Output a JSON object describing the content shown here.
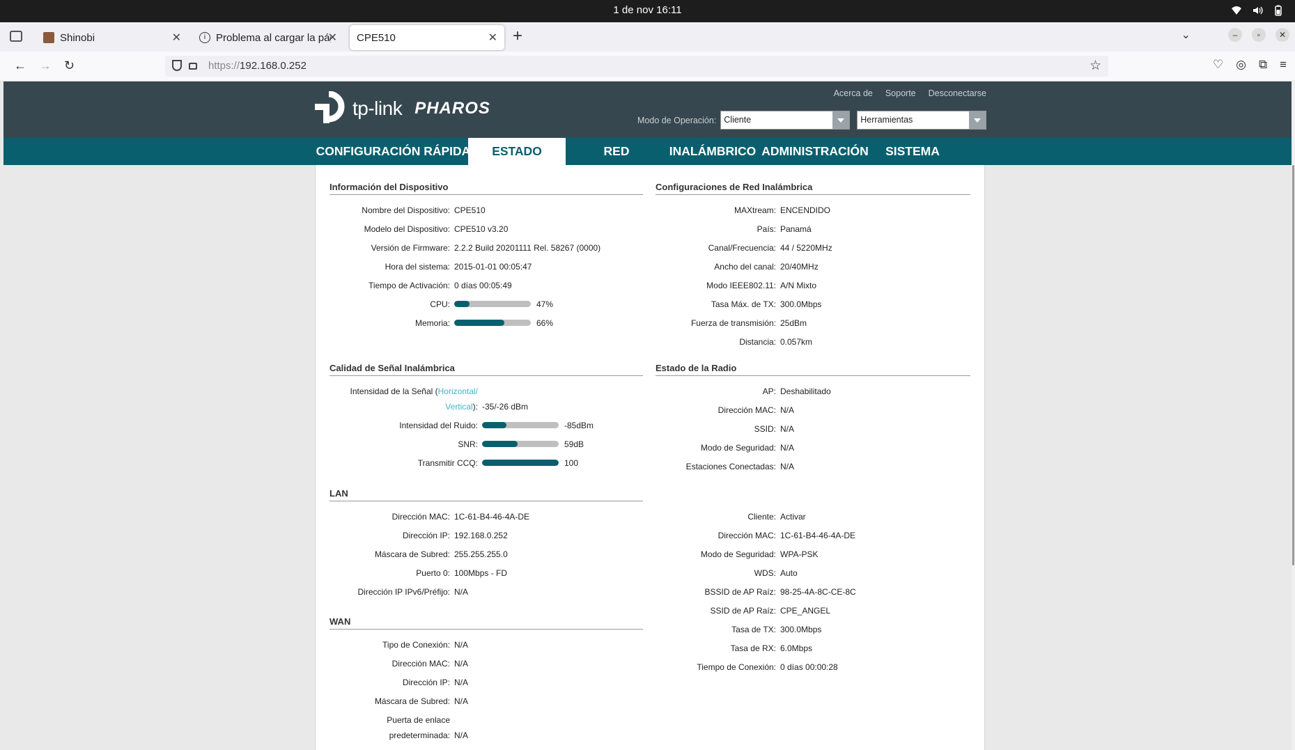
{
  "os": {
    "clock": "1 de nov  16:11"
  },
  "browser": {
    "tabs": [
      {
        "title": "Shinobi",
        "icon": "shinobi-icon"
      },
      {
        "title": "Problema al cargar la pág",
        "icon": "info-icon"
      },
      {
        "title": "CPE510",
        "icon": "",
        "active": true
      }
    ],
    "url_proto": "https://",
    "url_host": "192.168.0.252"
  },
  "header": {
    "brand": "tp-link",
    "product": "PHAROS",
    "links": [
      "Acerca de",
      "Soporte",
      "Desconectarse"
    ],
    "opmode_label": "Modo de Operación:",
    "opmode_value": "Cliente",
    "tools_value": "Herramientas"
  },
  "nav": [
    "CONFIGURACIÓN RÁPIDA",
    "ESTADO",
    "RED",
    "INALÁMBRICO",
    "ADMINISTRACIÓN",
    "SISTEMA"
  ],
  "device": {
    "title": "Información del Dispositivo",
    "rows": [
      {
        "label": "Nombre del Dispositivo:",
        "value": "CPE510"
      },
      {
        "label": "Modelo del Dispositivo:",
        "value": "CPE510 v3.20"
      },
      {
        "label": "Versión de Firmware:",
        "value": "2.2.2 Build 20201111 Rel. 58267 (0000)"
      },
      {
        "label": "Hora del sistema:",
        "value": "2015-01-01 00:05:47"
      },
      {
        "label": "Tiempo de Activación:",
        "value": "0 días 00:05:49"
      }
    ],
    "cpu_label": "CPU:",
    "cpu_text": "47%",
    "cpu_level": 0.2,
    "mem_label": "Memoria:",
    "mem_text": "66%",
    "mem_level": 0.65
  },
  "wireless_config": {
    "title": "Configuraciones de Red Inalámbrica",
    "rows": [
      {
        "label": "MAXtream:",
        "value": "ENCENDIDO"
      },
      {
        "label": "País:",
        "value": "Panamá"
      },
      {
        "label": "Canal/Frecuencia:",
        "value": "44 / 5220MHz"
      },
      {
        "label": "Ancho del canal:",
        "value": "20/40MHz"
      },
      {
        "label": "Modo IEEE802.11:",
        "value": "A/N Mixto"
      },
      {
        "label": "Tasa Máx. de TX:",
        "value": "300.0Mbps"
      },
      {
        "label": "Fuerza de transmisión:",
        "value": "25dBm"
      },
      {
        "label": "Distancia:",
        "value": "0.057km"
      }
    ]
  },
  "signal": {
    "title": "Calidad de Señal Inalámbrica",
    "strength_label_a": "Intensidad de la Señal (",
    "strength_link_a": "Horizontal/",
    "strength_link_b": "Vertical",
    "strength_label_b": "):",
    "strength_value": "-35/-26 dBm",
    "noise_label": "Intensidad del Ruido:",
    "noise_text": "-85dBm",
    "noise_level": 0.32,
    "snr_label": "SNR:",
    "snr_text": "59dB",
    "snr_level": 0.46,
    "ccq_label": "Transmitir CCQ:",
    "ccq_text": "100",
    "ccq_level": 1.0
  },
  "radio": {
    "title": "Estado de la Radio",
    "rows": [
      {
        "label": "AP:",
        "value": "Deshabilitado"
      },
      {
        "label": "Dirección MAC:",
        "value": "N/A"
      },
      {
        "label": "SSID:",
        "value": "N/A"
      },
      {
        "label": "Modo de Seguridad:",
        "value": "N/A"
      },
      {
        "label": "Estaciones Conectadas:",
        "value": "N/A"
      }
    ],
    "client_rows": [
      {
        "label": "Cliente:",
        "value": "Activar"
      },
      {
        "label": "Dirección MAC:",
        "value": "1C-61-B4-46-4A-DE"
      },
      {
        "label": "Modo de Seguridad:",
        "value": "WPA-PSK"
      },
      {
        "label": "WDS:",
        "value": "Auto"
      },
      {
        "label": "BSSID de AP Raíz:",
        "value": "98-25-4A-8C-CE-8C"
      },
      {
        "label": "SSID de AP Raíz:",
        "value": "CPE_ANGEL"
      },
      {
        "label": "Tasa de TX:",
        "value": "300.0Mbps"
      },
      {
        "label": "Tasa de RX:",
        "value": "6.0Mbps"
      },
      {
        "label": "Tiempo de Conexión:",
        "value": "0 días 00:00:28"
      }
    ]
  },
  "lan": {
    "title": "LAN",
    "rows": [
      {
        "label": "Dirección MAC:",
        "value": "1C-61-B4-46-4A-DE"
      },
      {
        "label": "Dirección IP:",
        "value": "192.168.0.252"
      },
      {
        "label": "Máscara de Subred:",
        "value": "255.255.255.0"
      },
      {
        "label": "Puerto 0:",
        "value": "100Mbps - FD"
      },
      {
        "label": "Dirección IP IPv6/Préfijo:",
        "value": "N/A"
      }
    ]
  },
  "wan": {
    "title": "WAN",
    "rows": [
      {
        "label": "Tipo de Conexión:",
        "value": "N/A"
      },
      {
        "label": "Dirección MAC:",
        "value": "N/A"
      },
      {
        "label": "Dirección IP:",
        "value": "N/A"
      },
      {
        "label": "Máscara de Subred:",
        "value": "N/A"
      }
    ],
    "gateway_label_a": "Puerta de enlace",
    "gateway_label_b": "predeterminada:",
    "gateway_value": "N/A"
  }
}
